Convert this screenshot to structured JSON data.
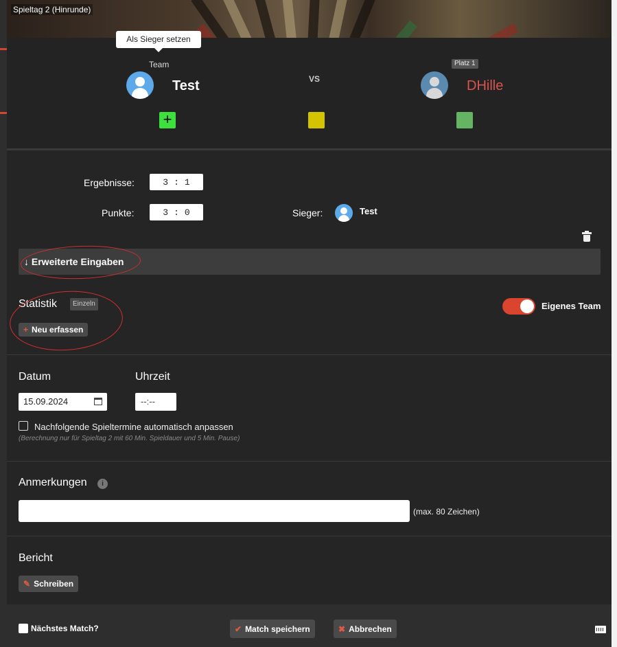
{
  "header": {
    "title": "Spieltag 2 (Hinrunde)"
  },
  "matchup": {
    "tooltip": "Als Sieger setzen",
    "home_label": "Team",
    "home_name": "Test",
    "vs": "VS",
    "guest_badge": "Platz 1",
    "guest_name": "DHille",
    "home_button_icon": "+"
  },
  "results": {
    "ergebnisse_label": "Ergebnisse:",
    "ergebnisse_home": "3",
    "ergebnisse_sep": ":",
    "ergebnisse_guest": "1",
    "punkte_label": "Punkte:",
    "punkte_home": "3",
    "punkte_sep": ":",
    "punkte_guest": "0",
    "sieger_label": "Sieger:",
    "sieger_name": "Test"
  },
  "erweitert": {
    "arrow": "↓",
    "label": "Erweiterte Eingaben"
  },
  "statistik": {
    "title": "Statistik",
    "badge": "Einzeln",
    "new_icon": "+",
    "new_label": "Neu erfassen",
    "toggle_label": "Eigenes Team",
    "toggle_on": true
  },
  "schedule": {
    "date_label": "Datum",
    "time_label": "Uhrzeit",
    "date_value": "15.09.2024",
    "time_value": "--:--",
    "auto_adjust_label": "Nachfolgende Spieltermine automatisch anpassen",
    "hint": "(Berechnung nur für Spieltag 2 mit 60 Min. Spieldauer und 5 Min. Pause)"
  },
  "notes": {
    "title": "Anmerkungen",
    "info_icon": "i",
    "value": "",
    "max_hint": "(max. 80 Zeichen)"
  },
  "report": {
    "title": "Bericht",
    "write_icon": "✎",
    "write_label": "Schreiben"
  },
  "footer": {
    "next_match_label": "Nächstes Match?",
    "save_icon": "✔",
    "save_label": "Match speichern",
    "cancel_icon": "✖",
    "cancel_label": "Abbrechen"
  },
  "colors": {
    "accent": "#d9452f",
    "guest_name": "#d9534f",
    "home_win": "#3ee03e",
    "draw": "#d4c400",
    "guest_win": "#64b464",
    "avatar": "#5da9e9"
  },
  "icons": [
    "user-avatar-icon",
    "trash-icon",
    "arrow-down-icon",
    "plus-icon",
    "calendar-icon",
    "info-icon",
    "pencil-icon",
    "checkmark-icon",
    "x-icon",
    "keyboard-icon"
  ]
}
